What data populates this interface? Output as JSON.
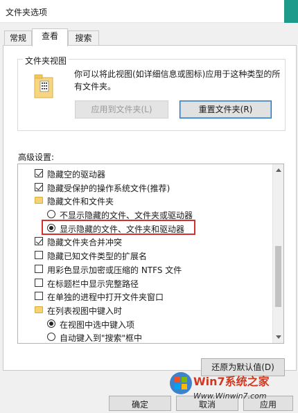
{
  "window": {
    "title": "文件夹选项"
  },
  "tabs": [
    {
      "label": "常规",
      "active": false
    },
    {
      "label": "查看",
      "active": true
    },
    {
      "label": "搜索",
      "active": false
    }
  ],
  "folder_view": {
    "legend": "文件夹视图",
    "description": "你可以将此视图(如详细信息或图标)应用于这种类型的所有文件夹。",
    "apply_button": "应用到文件夹(L)",
    "reset_button": "重置文件夹(R)"
  },
  "advanced": {
    "label": "高级设置:",
    "items": [
      {
        "type": "checkbox",
        "checked": true,
        "indent": 0,
        "label": "隐藏空的驱动器"
      },
      {
        "type": "checkbox",
        "checked": true,
        "indent": 0,
        "label": "隐藏受保护的操作系统文件(推荐)"
      },
      {
        "type": "folder",
        "checked": false,
        "indent": 0,
        "label": "隐藏文件和文件夹"
      },
      {
        "type": "radio",
        "checked": false,
        "indent": 1,
        "label": "不显示隐藏的文件、文件夹或驱动器"
      },
      {
        "type": "radio",
        "checked": true,
        "indent": 1,
        "label": "显示隐藏的文件、文件夹和驱动器"
      },
      {
        "type": "checkbox",
        "checked": true,
        "indent": 0,
        "label": "隐藏文件夹合并冲突"
      },
      {
        "type": "checkbox",
        "checked": false,
        "indent": 0,
        "label": "隐藏已知文件类型的扩展名"
      },
      {
        "type": "checkbox",
        "checked": false,
        "indent": 0,
        "label": "用彩色显示加密或压缩的 NTFS 文件"
      },
      {
        "type": "checkbox",
        "checked": false,
        "indent": 0,
        "label": "在标题栏中显示完整路径"
      },
      {
        "type": "checkbox",
        "checked": false,
        "indent": 0,
        "label": "在单独的进程中打开文件夹窗口"
      },
      {
        "type": "folder",
        "checked": false,
        "indent": 0,
        "label": "在列表视图中键入时"
      },
      {
        "type": "radio",
        "checked": true,
        "indent": 1,
        "label": "在视图中选中键入项"
      },
      {
        "type": "radio",
        "checked": false,
        "indent": 1,
        "label": "自动键入到\"搜索\"框中"
      }
    ]
  },
  "restore_button": "还原为默认值(D)",
  "footer": {
    "ok": "确定",
    "cancel": "取消",
    "apply": "应用"
  },
  "watermark": {
    "brand": "Win7系统之家",
    "url": "Www.Winwin7.com"
  },
  "colors": {
    "accent": "#1f6fc4",
    "highlight": "#d32f2f",
    "watermark": "#d2381f"
  }
}
